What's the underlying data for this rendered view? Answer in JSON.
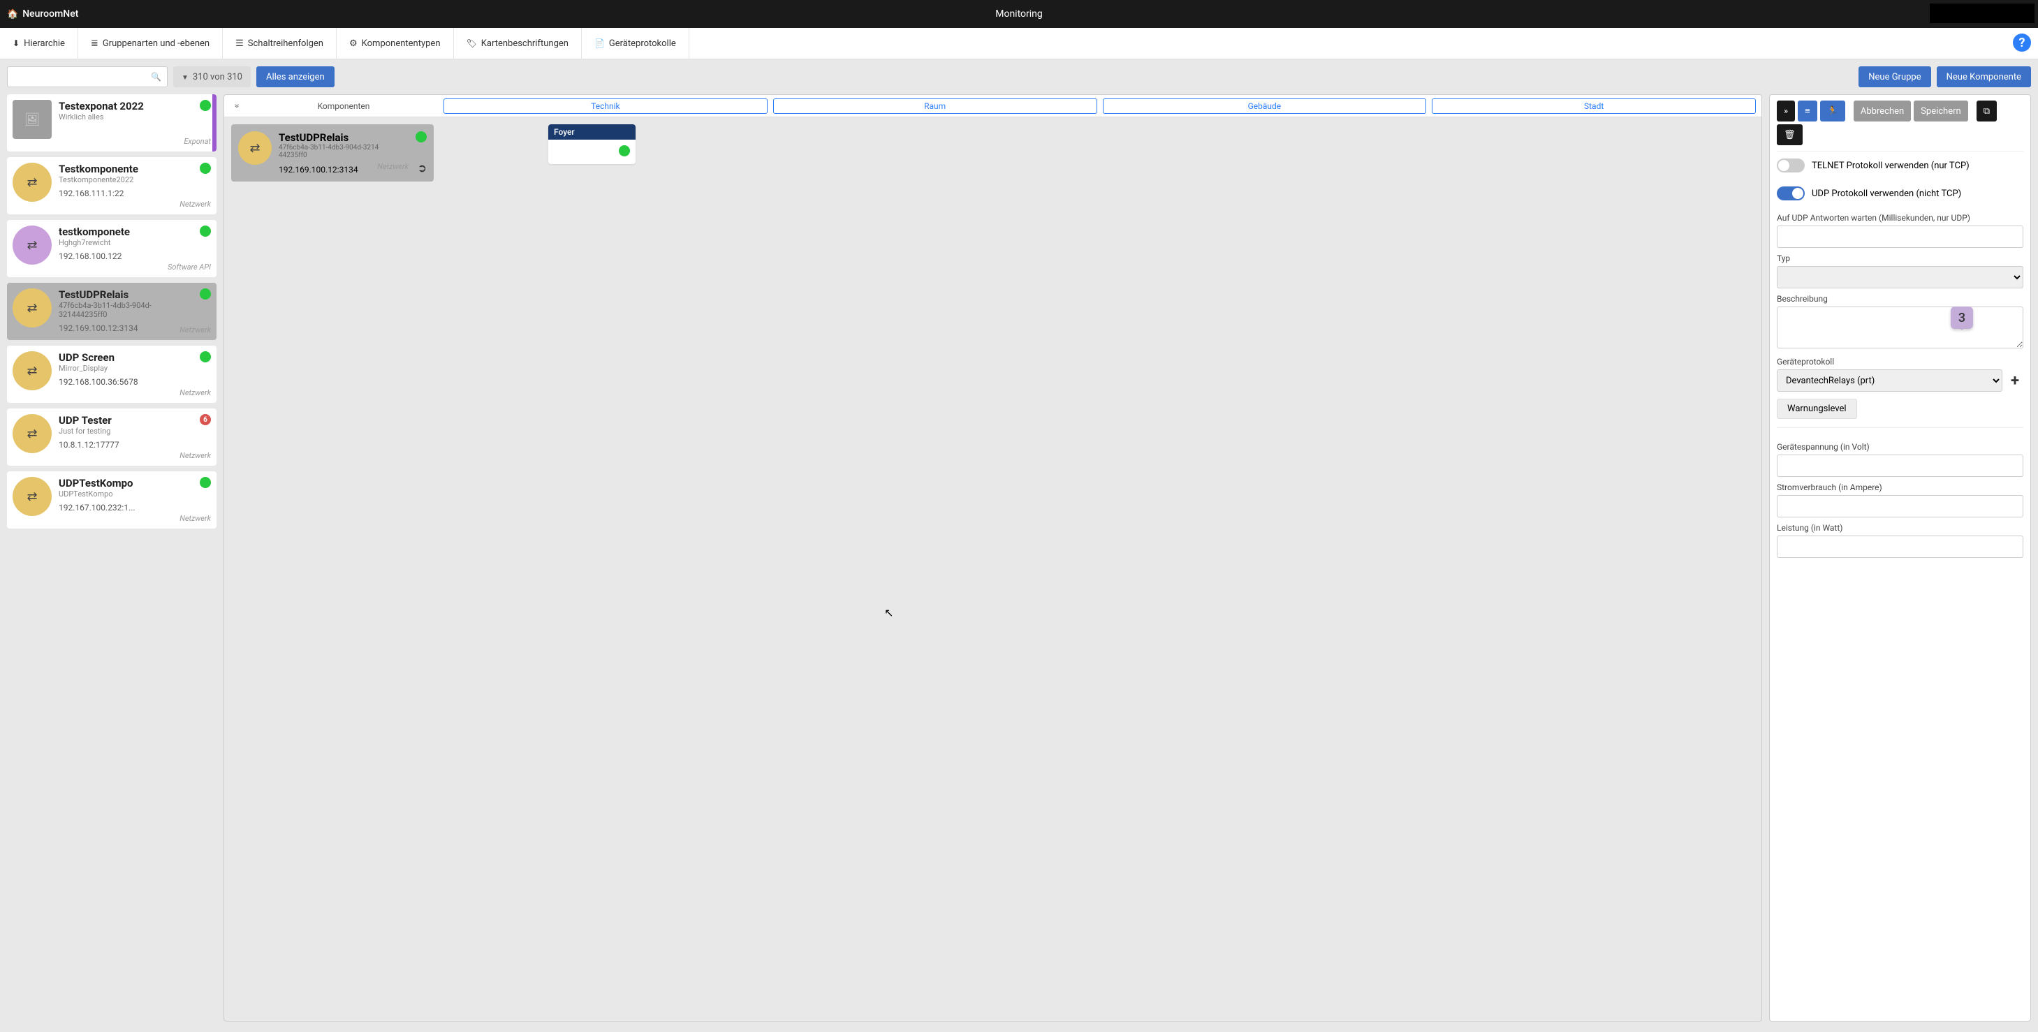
{
  "app": {
    "name": "NeuroomNet",
    "page": "Monitoring"
  },
  "menubar": {
    "hierarchie": "Hierarchie",
    "gruppenarten": "Gruppenarten und -ebenen",
    "schaltreihenfolgen": "Schaltreihenfolgen",
    "komponententypen": "Komponententypen",
    "kartenbeschriftungen": "Kartenbeschriftungen",
    "geraeteprotokolle": "Geräteprotokolle"
  },
  "toolbar": {
    "filter_label": "310 von 310",
    "show_all": "Alles anzeigen",
    "new_group": "Neue Gruppe",
    "new_component": "Neue Komponente"
  },
  "sidebar": [
    {
      "title": "Testexponat 2022",
      "sub": "Wirklich alles",
      "addr": "",
      "type": "Exponat",
      "icon": "img",
      "status": "green",
      "accent": "purple"
    },
    {
      "title": "Testkomponente",
      "sub": "Testkomponente2022",
      "addr": "192.168.111.1:22",
      "type": "Netzwerk",
      "icon": "yellow",
      "status": "green"
    },
    {
      "title": "testkomponete",
      "sub": "Hghgh7rewicht",
      "addr": "192.168.100.122",
      "type": "Software API",
      "icon": "purple",
      "status": "green"
    },
    {
      "title": "TestUDPRelais",
      "sub": "47f6cb4a-3b11-4db3-904d-321444235ff0",
      "addr": "192.169.100.12:3134",
      "type": "Netzwerk",
      "icon": "yellow",
      "status": "green",
      "selected": true
    },
    {
      "title": "UDP Screen",
      "sub": "Mirror_Display",
      "addr": "192.168.100.36:5678",
      "type": "Netzwerk",
      "icon": "yellow",
      "status": "green"
    },
    {
      "title": "UDP Tester",
      "sub": "Just for testing",
      "addr": "10.8.1.12:17777",
      "type": "Netzwerk",
      "icon": "yellow",
      "status": "red",
      "badge": "6"
    },
    {
      "title": "UDPTestKompo",
      "sub": "UDPTestKompo",
      "addr": "192.167.100.232:1...",
      "type": "Netzwerk",
      "icon": "yellow",
      "status": "green"
    }
  ],
  "center": {
    "header": {
      "komponenten": "Komponenten",
      "technik": "Technik",
      "raum": "Raum",
      "gebaeude": "Gebäude",
      "stadt": "Stadt"
    },
    "component": {
      "title": "TestUDPRelais",
      "sub1": "47f6cb4a-3b11-4db3-904d-3214",
      "sub2": "44235ff0",
      "addr": "192.169.100.12:3134",
      "type": "Netzwerk"
    },
    "room": {
      "name": "Foyer"
    }
  },
  "panel": {
    "cancel": "Abbrechen",
    "save": "Speichern",
    "toggle_telnet": "TELNET Protokoll verwenden (nur TCP)",
    "toggle_udp": "UDP Protokoll verwenden (nicht TCP)",
    "labels": {
      "udp_wait": "Auf UDP Antworten warten (Millisekunden, nur UDP)",
      "typ": "Typ",
      "beschreibung": "Beschreibung",
      "geraeteprotokoll": "Geräteprotokoll",
      "warnungslevel": "Warnungslevel",
      "spannung": "Gerätespannung (in Volt)",
      "strom": "Stromverbrauch (in Ampere)",
      "leistung": "Leistung (in Watt)"
    },
    "protokoll_value": "DevantechRelays (prt)",
    "callout": "3"
  }
}
